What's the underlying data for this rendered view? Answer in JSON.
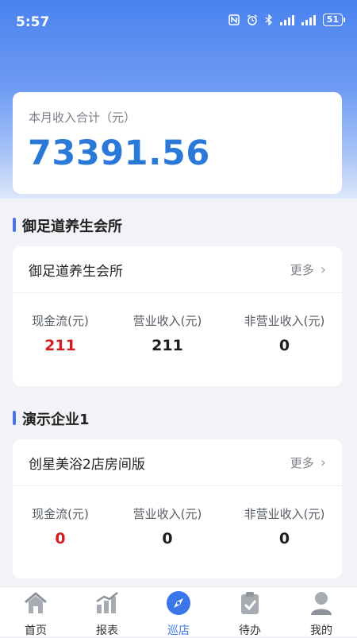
{
  "status_bar": {
    "time": "5:57",
    "battery": "51"
  },
  "summary": {
    "label": "本月收入合计（元）",
    "value": "73391.56"
  },
  "sections": [
    {
      "title": "御足道养生会所",
      "store_name": "御足道养生会所",
      "more_label": "更多",
      "stats": [
        {
          "label": "现金流(元)",
          "value": "211"
        },
        {
          "label": "营业收入(元)",
          "value": "211"
        },
        {
          "label": "非营业收入(元)",
          "value": "0"
        }
      ]
    },
    {
      "title": "演示企业1",
      "store_name": "创星美浴2店房间版",
      "more_label": "更多",
      "stats": [
        {
          "label": "现金流(元)",
          "value": "0"
        },
        {
          "label": "营业收入(元)",
          "value": "0"
        },
        {
          "label": "非营业收入(元)",
          "value": "0"
        }
      ]
    }
  ],
  "tabbar": {
    "items": [
      {
        "label": "首页",
        "icon": "home-icon"
      },
      {
        "label": "报表",
        "icon": "report-chart-icon"
      },
      {
        "label": "巡店",
        "icon": "compass-icon"
      },
      {
        "label": "待办",
        "icon": "clipboard-check-icon"
      },
      {
        "label": "我的",
        "icon": "user-icon"
      }
    ],
    "active_index": 2
  },
  "colors": {
    "header_blue": "#4a82ef",
    "income_value": "#2a78d8",
    "cash_flow_red": "#d11f1f",
    "tab_active": "#3a76ea",
    "section_bar": "#4a74e6"
  }
}
